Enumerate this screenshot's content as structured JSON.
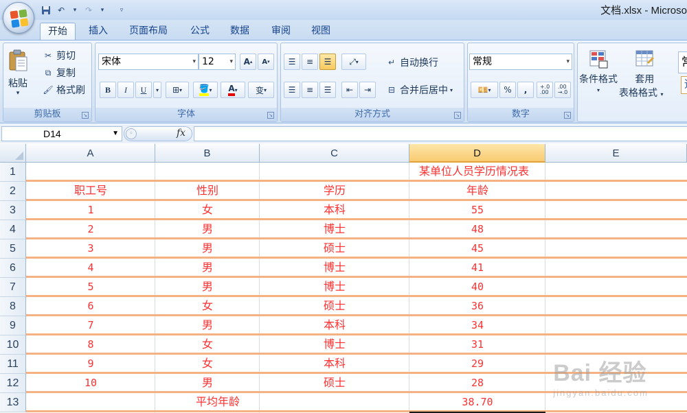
{
  "window": {
    "title": "文档.xlsx - Microso"
  },
  "tabs": [
    "开始",
    "插入",
    "页面布局",
    "公式",
    "数据",
    "审阅",
    "视图"
  ],
  "ribbon": {
    "clipboard": {
      "paste": "粘贴",
      "cut": "剪切",
      "copy": "复制",
      "format_painter": "格式刷",
      "label": "剪贴板"
    },
    "font": {
      "name": "宋体",
      "size": "12",
      "label": "字体",
      "bold": "B",
      "italic": "I",
      "underline": "U",
      "grow": "A",
      "shrink": "A",
      "font_color": "A",
      "phonetic": "变"
    },
    "alignment": {
      "wrap_text": "自动换行",
      "merge_center": "合并后居中",
      "label": "对齐方式"
    },
    "number": {
      "format": "常规",
      "percent": "%",
      "comma": ",",
      "inc_decimal": "+.0\n.00",
      "dec_decimal": ".00\n→.0",
      "label": "数字"
    },
    "styles": {
      "conditional_format": "条件格式",
      "format_as_table_1": "套用",
      "format_as_table_2": "表格格式",
      "partial_1": "常",
      "partial_2": "适"
    }
  },
  "formula_bar": {
    "name_box": "D14",
    "fx": "fx",
    "value": ""
  },
  "sheet": {
    "columns": [
      "A",
      "B",
      "C",
      "D",
      "E"
    ],
    "selected_column": "D",
    "title": "某单位人员学历情况表",
    "headers": [
      "职工号",
      "性别",
      "学历",
      "年龄"
    ],
    "rows": [
      [
        "1",
        "女",
        "本科",
        "55"
      ],
      [
        "2",
        "男",
        "博士",
        "48"
      ],
      [
        "3",
        "男",
        "硕士",
        "45"
      ],
      [
        "4",
        "男",
        "博士",
        "41"
      ],
      [
        "5",
        "男",
        "博士",
        "40"
      ],
      [
        "6",
        "女",
        "硕士",
        "36"
      ],
      [
        "7",
        "男",
        "本科",
        "34"
      ],
      [
        "8",
        "女",
        "博士",
        "31"
      ],
      [
        "9",
        "女",
        "本科",
        "29"
      ],
      [
        "10",
        "男",
        "硕士",
        "28"
      ]
    ],
    "avg_label": "平均年龄",
    "avg_value": "38.70",
    "text_color": "#ff3030",
    "border_color": "#f4b183"
  },
  "watermark": {
    "main": "Bai 经验",
    "sub": "jingyan.baidu.com"
  }
}
